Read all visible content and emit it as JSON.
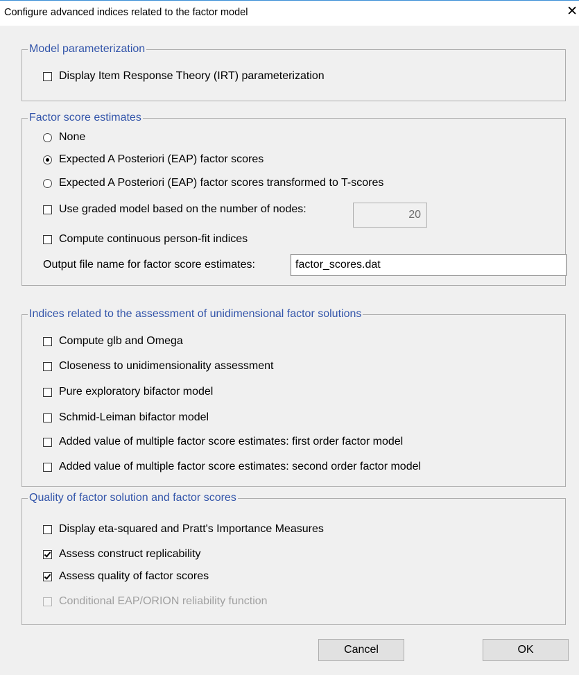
{
  "window": {
    "title": "Configure advanced indices related to the factor model",
    "close_glyph": "✕"
  },
  "model_param": {
    "legend": "Model parameterization",
    "irt": {
      "label": "Display Item Response Theory (IRT) parameterization",
      "checked": false
    }
  },
  "factor_scores": {
    "legend": "Factor score estimates",
    "radios": [
      {
        "label": "None",
        "checked": false
      },
      {
        "label": "Expected A Posteriori (EAP) factor scores",
        "checked": true
      },
      {
        "label": "Expected A Posteriori (EAP) factor scores  transformed to T-scores",
        "checked": false
      }
    ],
    "graded": {
      "label": "Use graded model based on the number of nodes:",
      "checked": false,
      "nodes_value": "20"
    },
    "personfit": {
      "label": "Compute continuous person-fit indices",
      "checked": false
    },
    "output_label": "Output file name for factor score estimates:",
    "output_value": "factor_scores.dat"
  },
  "unidim": {
    "legend": "Indices related to the assessment of unidimensional factor solutions",
    "items": [
      {
        "label": "Compute glb and Omega",
        "checked": false
      },
      {
        "label": "Closeness to unidimensionality assessment",
        "checked": false
      },
      {
        "label": "Pure exploratory bifactor model",
        "checked": false
      },
      {
        "label": "Schmid-Leiman bifactor model",
        "checked": false
      },
      {
        "label": "Added value of multiple factor score estimates: first order factor model",
        "checked": false
      },
      {
        "label": "Added value of multiple factor score estimates: second order factor model",
        "checked": false
      }
    ]
  },
  "quality": {
    "legend": "Quality of factor solution and factor scores",
    "items": [
      {
        "label": "Display eta-squared and Pratt's Importance Measures",
        "checked": false,
        "enabled": true
      },
      {
        "label": "Assess construct replicability",
        "checked": true,
        "enabled": true
      },
      {
        "label": "Assess quality of factor scores",
        "checked": true,
        "enabled": true
      },
      {
        "label": "Conditional EAP/ORION reliability function",
        "checked": false,
        "enabled": false
      }
    ]
  },
  "buttons": {
    "cancel": "Cancel",
    "ok": "OK"
  }
}
